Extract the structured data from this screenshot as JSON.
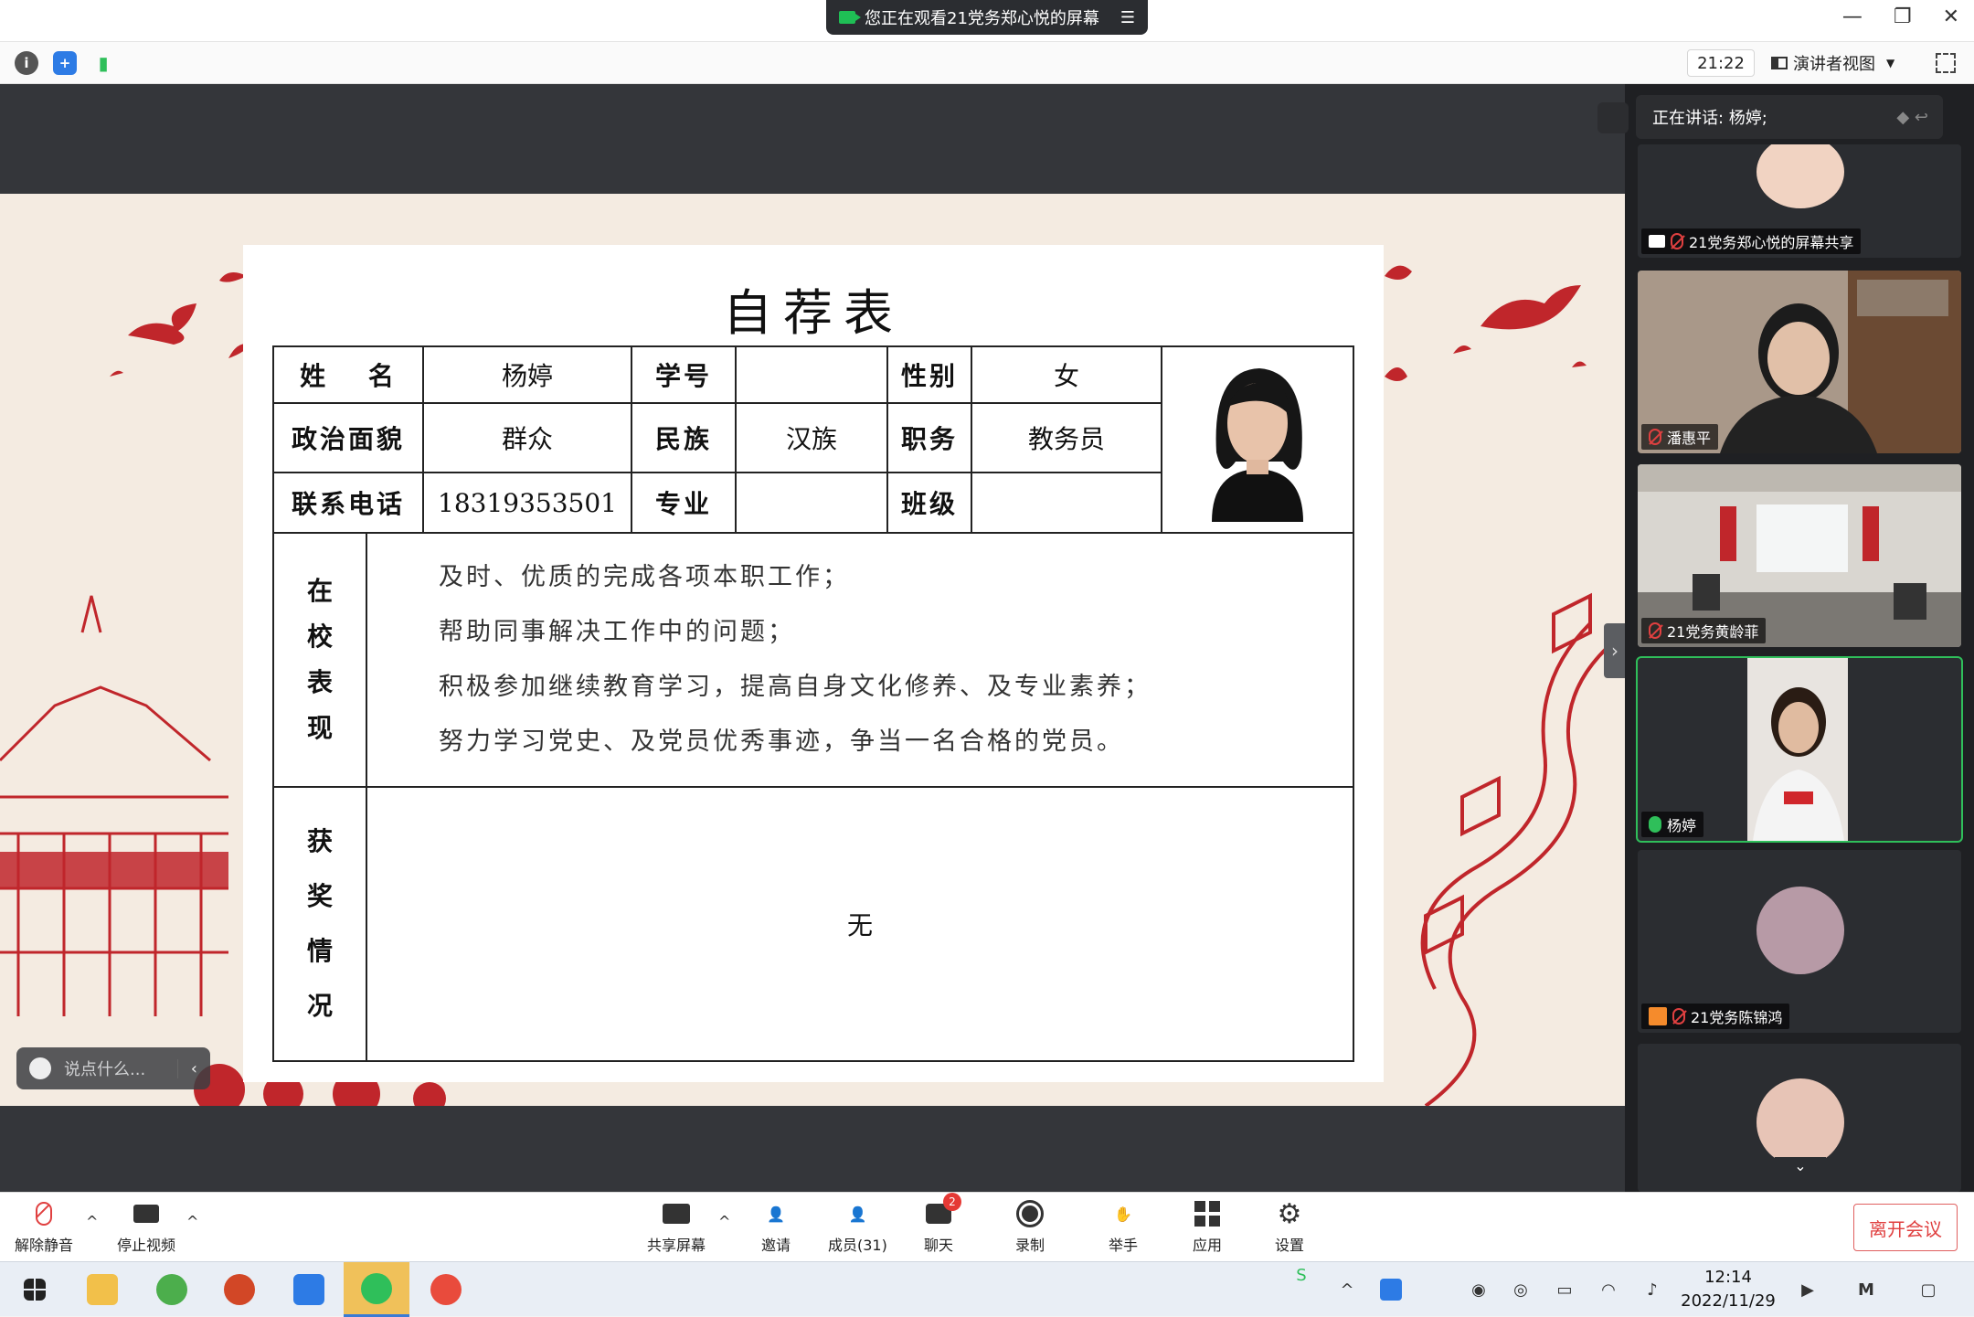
{
  "window": {
    "share_banner": "您正在观看21党务郑心悦的屏幕",
    "time": "21:22",
    "view_label": "演讲者视图"
  },
  "slide": {
    "title": "自荐表",
    "form": {
      "name_label": "姓　 名",
      "name_value": "杨婷",
      "student_id_label": "学号",
      "student_id_value": "",
      "gender_label": "性别",
      "gender_value": "女",
      "political_label": "政治面貌",
      "political_value": "群众",
      "ethnicity_label": "民族",
      "ethnicity_value": "汉族",
      "position_label": "职务",
      "position_value": "教务员",
      "phone_label": "联系电话",
      "phone_value": "18319353501",
      "major_label": "专业",
      "major_value": "",
      "class_label": "班级",
      "class_value": "",
      "performance_label": [
        "在",
        "校",
        "表",
        "现"
      ],
      "performance_lines": [
        "及时、优质的完成各项本职工作；",
        "帮助同事解决工作中的问题；",
        "积极参加继续教育学习，提高自身文化修养、及专业素养；",
        "努力学习党史、及党员优秀事迹，争当一名合格的党员。"
      ],
      "awards_label": [
        "获",
        "奖",
        "情",
        "况"
      ],
      "awards_value": "无"
    },
    "chat_placeholder": "说点什么..."
  },
  "right_panel": {
    "speaking": "正在讲话: 杨婷;",
    "tiles": [
      {
        "name": "21党务郑心悦的屏幕共享",
        "muted": true
      },
      {
        "name": "潘惠平",
        "muted": true
      },
      {
        "name": "21党务黄龄菲",
        "muted": true
      },
      {
        "name": "杨婷",
        "muted": false
      },
      {
        "name": "21党务陈锦鸿",
        "muted": true
      },
      {
        "name": "",
        "muted": false
      }
    ]
  },
  "bottom_bar": {
    "unmute": "解除静音",
    "stop_video": "停止视频",
    "share_screen": "共享屏幕",
    "invite": "邀请",
    "members": "成员(31)",
    "chat": "聊天",
    "chat_badge": "2",
    "record": "录制",
    "raise_hand": "举手",
    "apps": "应用",
    "settings": "设置",
    "leave": "离开会议"
  },
  "taskbar": {
    "time": "12:14",
    "date": "2022/11/29"
  },
  "colors": {
    "accent_red": "#c0262b",
    "active_green": "#2fbf5a"
  }
}
